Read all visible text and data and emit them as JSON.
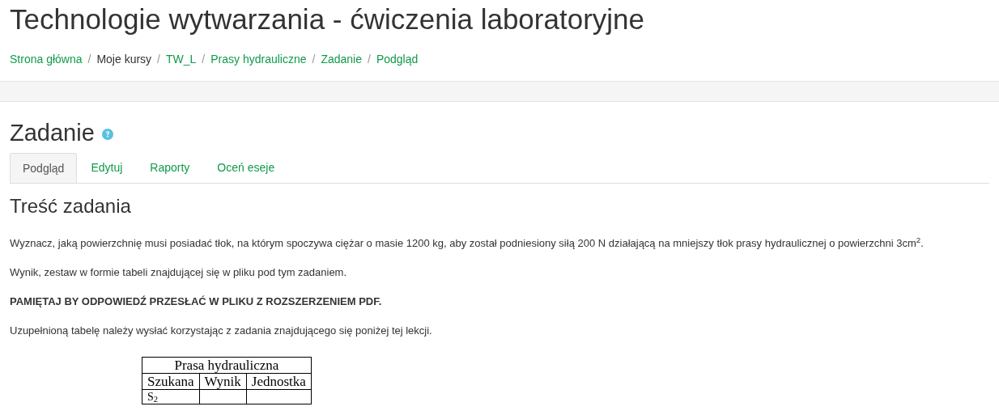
{
  "page_title": "Technologie wytwarzania - ćwiczenia laboratoryjne",
  "breadcrumb_separator": "/",
  "breadcrumb": [
    {
      "label": "Strona główna",
      "kind": "link"
    },
    {
      "label": "Moje kursy",
      "kind": "text"
    },
    {
      "label": "TW_L",
      "kind": "link"
    },
    {
      "label": "Prasy hydrauliczne",
      "kind": "link"
    },
    {
      "label": "Zadanie",
      "kind": "link"
    },
    {
      "label": "Podgląd",
      "kind": "link"
    }
  ],
  "heading": "Zadanie",
  "tabs": [
    {
      "label": "Podgląd",
      "selected": true
    },
    {
      "label": "Edytuj",
      "selected": false
    },
    {
      "label": "Raporty",
      "selected": false
    },
    {
      "label": "Oceń eseje",
      "selected": false
    }
  ],
  "section_title": "Treść zadania",
  "paragraphs": [
    {
      "text": "Wyznacz, jaką powierzchnię musi posiadać tłok, na którym spoczywa ciężar o masie 1200 kg, aby został podniesiony siłą 200 N działającą na mniejszy tłok prasy hydraulicznej o powierzchni 3cm$^{2}$.",
      "kind": "normal"
    },
    {
      "text": "Wynik, zestaw w formie tabeli znajdującej się w pliku pod tym zadaniem.",
      "kind": "normal"
    },
    {
      "text": "PAMIĘTAJ BY ODPOWIEDŹ PRZESŁAĆ W PLIKU Z ROZSZERZENIEM PDF.",
      "kind": "bold"
    },
    {
      "text": "Uzupełnioną tabelę należy wysłać korzystając z zadania znajdującego się poniżej tej lekcji.",
      "kind": "normal"
    }
  ],
  "table": {
    "title": "Prasa hydrauliczna",
    "columns": [
      "Szukana",
      "Wynik",
      "Jednostka"
    ],
    "rows": [
      {
        "cells": [
          "S$_{2}$"
        ]
      }
    ]
  }
}
